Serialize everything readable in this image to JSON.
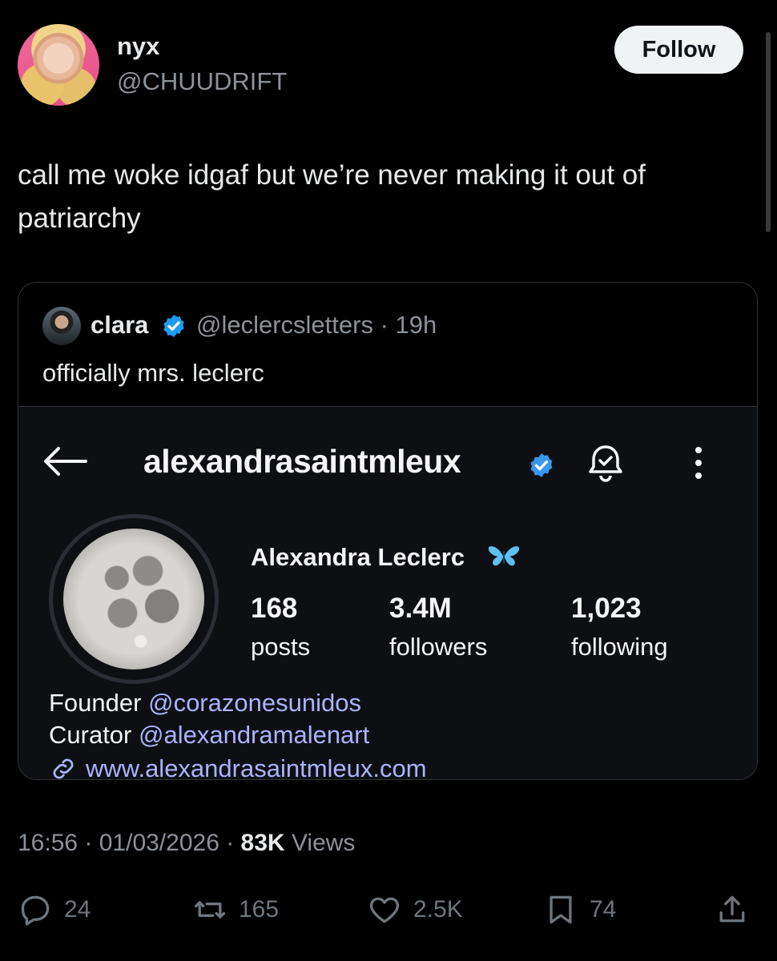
{
  "author": {
    "name": "nyx",
    "handle": "@CHUUDRIFT",
    "follow_label": "Follow"
  },
  "tweet": {
    "text": "call me woke idgaf but we’re never making it out of patriarchy"
  },
  "quote": {
    "name": "clara",
    "handle": "@leclercsletters · 19h",
    "text": "officially mrs. leclerc"
  },
  "embed": {
    "username": "alexandrasaintmleux",
    "full_name": "Alexandra Leclerc",
    "stats": [
      {
        "value": "168",
        "label": "posts"
      },
      {
        "value": "3.4M",
        "label": "followers"
      },
      {
        "value": "1,023",
        "label": "following"
      }
    ],
    "bio": [
      {
        "prefix": "Founder",
        "mention": "@corazonesunidos"
      },
      {
        "prefix": "Curator",
        "mention": "@alexandramalenart"
      }
    ],
    "link": "www.alexandrasaintmleux.com"
  },
  "meta": {
    "time_date": "16:56 · 01/03/2026 · ",
    "views_count": "83K",
    "views_label": "Views"
  },
  "actions": {
    "replies": "24",
    "reposts": "165",
    "likes": "2.5K",
    "bookmarks": "74"
  },
  "colors": {
    "background": "#000000",
    "verified": "#1d9bf0",
    "mention": "#a9b4ff",
    "muted": "#8b9299"
  }
}
